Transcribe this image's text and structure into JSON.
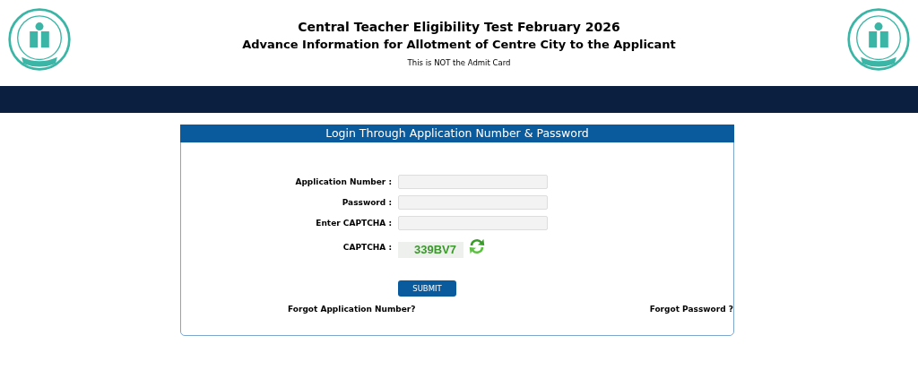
{
  "header": {
    "title": "Central Teacher Eligibility Test February 2026",
    "subtitle": "Advance Information for Allotment of Centre City to the Applicant",
    "note": "This is NOT the Admit Card"
  },
  "login": {
    "title": "Login Through Application Number & Password",
    "fields": [
      {
        "kind": "input",
        "label": "Application Number :"
      },
      {
        "kind": "input",
        "label": "Password :"
      },
      {
        "kind": "input",
        "label": "Enter CAPTCHA :"
      },
      {
        "kind": "captcha",
        "label": "CAPTCHA :",
        "code": "339BV7"
      }
    ],
    "submit": "SUBMIT",
    "links": [
      "Forgot Application Number?",
      "Forgot Password ?"
    ]
  }
}
